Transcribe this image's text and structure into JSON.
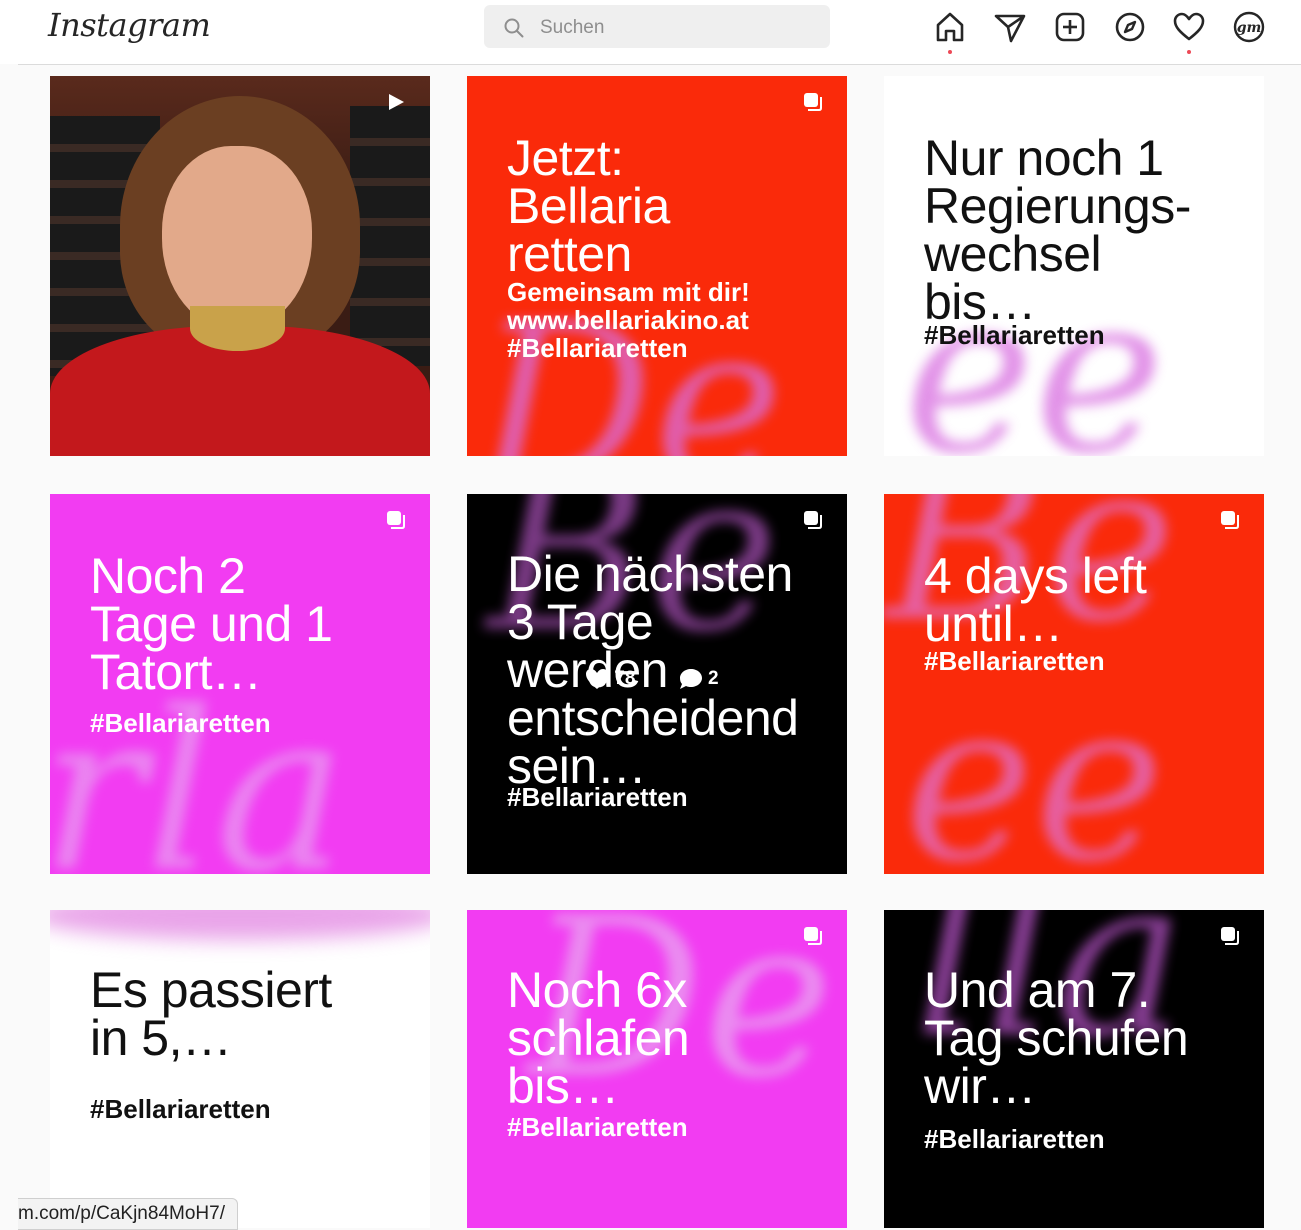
{
  "header": {
    "logo": "Instagram",
    "search_placeholder": "Suchen"
  },
  "nav_icons": [
    "home-icon",
    "direct-message-icon",
    "new-post-icon",
    "explore-icon",
    "activity-heart-icon",
    "profile-avatar-icon"
  ],
  "colors": {
    "red": "#fa2a0a",
    "magenta": "#f23cf2",
    "black": "#000000",
    "white": "#ffffff",
    "accent_dot": "#ed4956"
  },
  "tiles": [
    {
      "type": "video"
    },
    {
      "lines": [
        "Jetzt:",
        "Bellaria",
        "retten"
      ],
      "sub": [
        "Gemeinsam mit dir!",
        "www.bellariakino.at",
        "#Bellariaretten"
      ]
    },
    {
      "lines": [
        "Nur noch 1",
        "Regierungs-",
        "wechsel",
        "bis…"
      ],
      "tag": "#Bellariaretten"
    },
    {
      "lines": [
        "Noch 2",
        "Tage und 1",
        "Tatort…"
      ],
      "tag": "#Bellariaretten"
    },
    {
      "lines": [
        "Die nächsten",
        "3 Tage",
        "werden",
        "entscheidend",
        "sein…"
      ],
      "tag": "#Bellariaretten",
      "likes": "78",
      "comments": "2"
    },
    {
      "lines": [
        "4 days left",
        "until…"
      ],
      "tag": "#Bellariaretten"
    },
    {
      "lines": [
        "Es passiert",
        "in 5,…"
      ],
      "tag": "#Bellariaretten"
    },
    {
      "lines": [
        "Noch 6x",
        "schlafen",
        "bis…"
      ],
      "tag": "#Bellariaretten"
    },
    {
      "lines": [
        "Und am 7.",
        "Tag schufen",
        "wir…"
      ],
      "tag": "#Bellariaretten"
    }
  ],
  "status_url": "m.com/p/CaKjn84MoH7/"
}
